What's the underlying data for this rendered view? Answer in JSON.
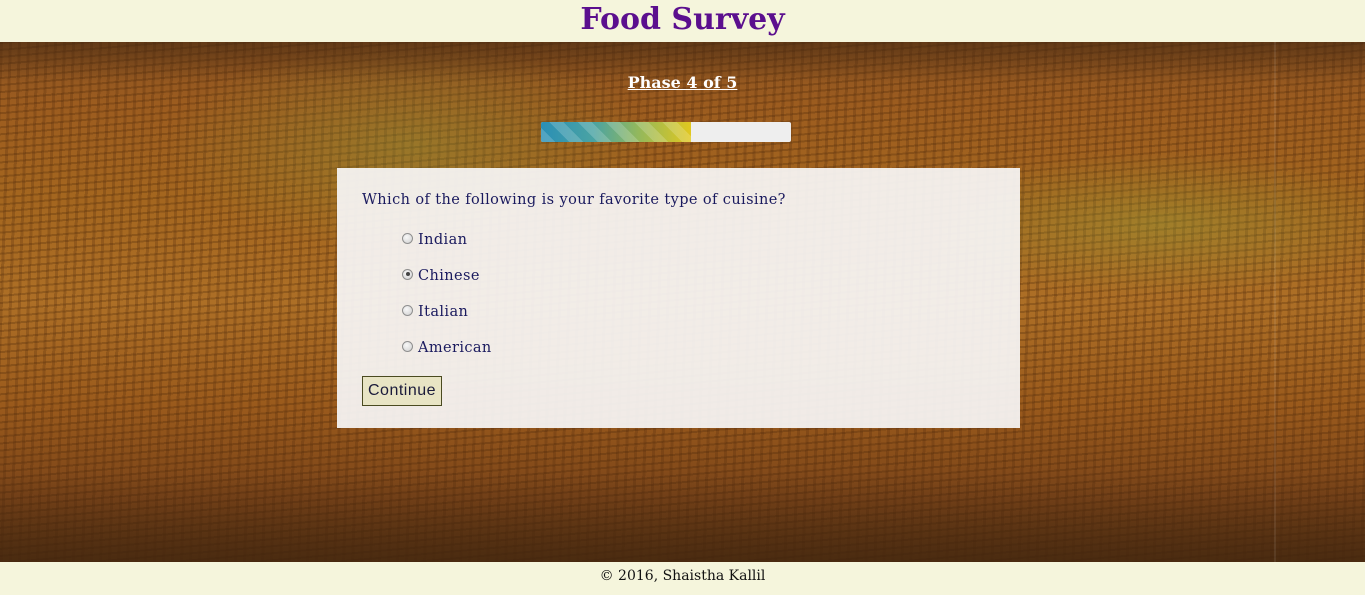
{
  "header": {
    "title": "Food Survey"
  },
  "survey": {
    "phase_label": "Phase 4 of 5",
    "progress_fraction": 0.6,
    "progress_colors": [
      "#2a8fb5",
      "#93b85c",
      "#e1c71f"
    ],
    "question": "Which of the following is your favorite type of cuisine?",
    "options": [
      {
        "label": "Indian",
        "selected": false
      },
      {
        "label": "Chinese",
        "selected": true
      },
      {
        "label": "Italian",
        "selected": false
      },
      {
        "label": "American",
        "selected": false
      }
    ],
    "continue_label": "Continue"
  },
  "footer": {
    "copyright": "© 2016, Shaistha Kallil"
  },
  "colors": {
    "title": "#5b0f8e",
    "banner": "#f5f5dc",
    "question_text": "#1a1a5e"
  }
}
